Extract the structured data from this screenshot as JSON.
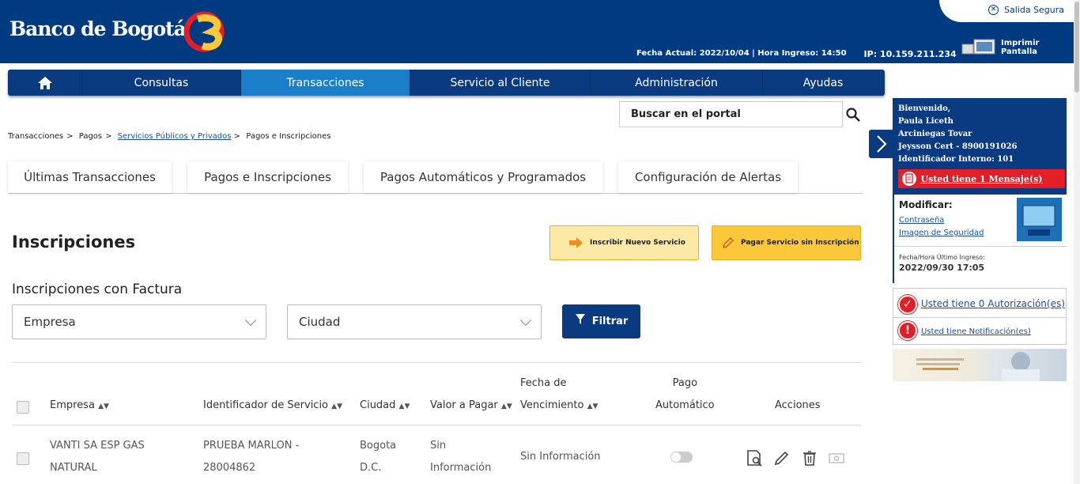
{
  "brand": {
    "name": "Banco de Bogotá"
  },
  "header": {
    "safe_exit": "Salida Segura",
    "print": "Imprimir Pantalla",
    "meta": "Fecha Actual: 2022/10/04 | Hora Ingreso: 14:50",
    "ip": "IP: 10.159.211.234"
  },
  "nav": {
    "items": [
      "Consultas",
      "Transacciones",
      "Servicio al Cliente",
      "Administración",
      "Ayudas"
    ]
  },
  "search": {
    "placeholder": "Buscar en el portal"
  },
  "breadcrumb": {
    "items": [
      "Transacciones",
      "Pagos",
      "Servicios Públicos y Privados",
      "Pagos e Inscripciones"
    ],
    "sep": ">"
  },
  "tabs": [
    "Últimas Transacciones",
    "Pagos e Inscripciones",
    "Pagos Automáticos y Programados",
    "Configuración de Alertas"
  ],
  "page": {
    "title": "Inscripciones",
    "subtitle": "Inscripciones con Factura",
    "btn_new": "Inscribir Nuevo Servicio",
    "btn_pay": "Pagar Servicio sin Inscripción"
  },
  "filters": {
    "company": "Empresa",
    "city": "Ciudad",
    "filter_btn": "Filtrar"
  },
  "table": {
    "headers": {
      "company": "Empresa",
      "service_id": "Identificador de Servicio",
      "city": "Ciudad",
      "amount": "Valor a Pagar",
      "due_1": "Fecha de",
      "due_2": "Vencimiento",
      "auto_1": "Pago",
      "auto_2": "Automático",
      "actions": "Acciones"
    },
    "rows": [
      {
        "company_1": "VANTI SA ESP GAS",
        "company_2": "NATURAL",
        "id_1": "PRUEBA MARLON -",
        "id_2": "28004862",
        "city_1": "Bogota",
        "city_2": "D.C.",
        "amount_1": "Sin",
        "amount_2": "Información",
        "due": "Sin Información"
      }
    ]
  },
  "sidebar": {
    "welcome_1": "Bienvenido,",
    "welcome_2": "Paula Liceth",
    "welcome_3": "Arciniegas Tovar",
    "welcome_4": "Jeysson Cert - 8900191026",
    "welcome_5": "Identificador Interno: 101",
    "message": "Usted tiene 1 Mensaje(s)",
    "modify": "Modificar:",
    "password": "Contraseña",
    "security_image": "Imagen de Seguridad",
    "last_login_label": "Fecha/Hora Último Ingreso:",
    "last_login": "2022/09/30 17:05",
    "authorizations": "Usted tiene 0 Autorización(es)",
    "notifications": "Usted tiene Notificación(es)"
  },
  "colors": {
    "primary": "#003a80",
    "active_nav": "#1a7fc8",
    "accent_yellow": "#fbc83a",
    "alert_red": "#e41e26"
  },
  "icons": [
    "home-icon",
    "search-icon",
    "close-circle-icon",
    "printer-icon",
    "arrow-right-icon",
    "pencil-icon",
    "filter-icon",
    "chevron-down-icon",
    "view-icon",
    "edit-icon",
    "trash-icon",
    "money-icon",
    "check-circle-icon",
    "alert-circle-icon",
    "document-icon"
  ]
}
